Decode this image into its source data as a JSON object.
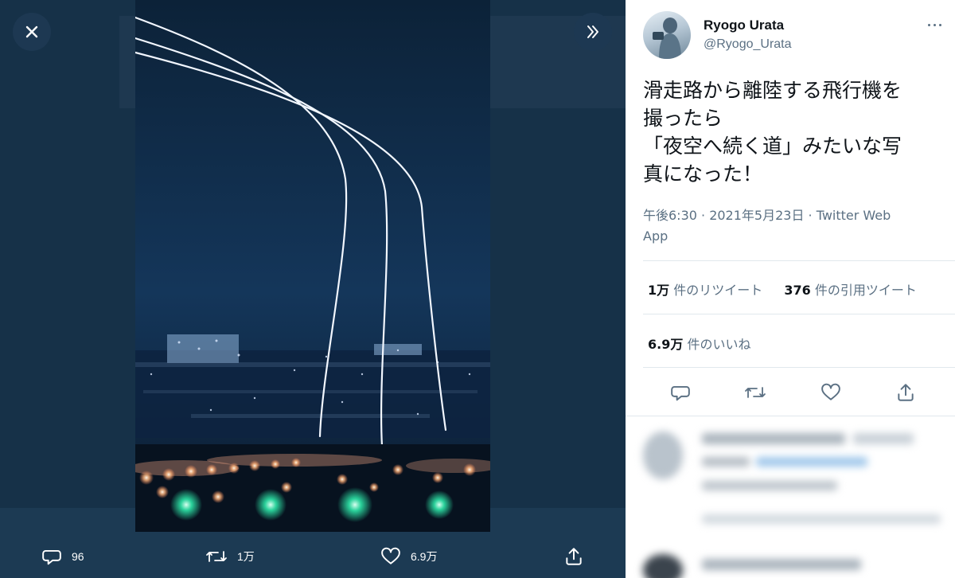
{
  "viewer": {
    "counts": {
      "replies": "96",
      "retweets": "1万",
      "likes": "6.9万"
    }
  },
  "tweet": {
    "author_name": "Ryogo Urata",
    "author_handle": "@Ryogo_Urata",
    "text_lines": [
      "滑走路から離陸する飛行機を",
      "撮ったら",
      "「夜空へ続く道」みたいな写",
      "真になった！"
    ],
    "meta_line1": "午後6:30 · 2021年5月23日 · Twitter Web",
    "meta_line2": "App",
    "retweets_value": "1万",
    "retweets_label": " 件のリツイート",
    "quotes_value": "376",
    "quotes_label": " 件の引用ツイート",
    "likes_value": "6.9万",
    "likes_label": " 件のいいね"
  },
  "icons": {
    "close": "close-icon",
    "next": "double-chevron-right-icon",
    "reply": "comment-icon",
    "retweet": "retweet-icon",
    "like": "heart-icon",
    "share": "share-icon",
    "more": "more-dots-icon"
  },
  "colors": {
    "panel_bg": "#ffffff",
    "viewer_bg": "#163148",
    "text": "#0f1419",
    "secondary": "#5b7083",
    "divider": "#e1e8ed"
  }
}
